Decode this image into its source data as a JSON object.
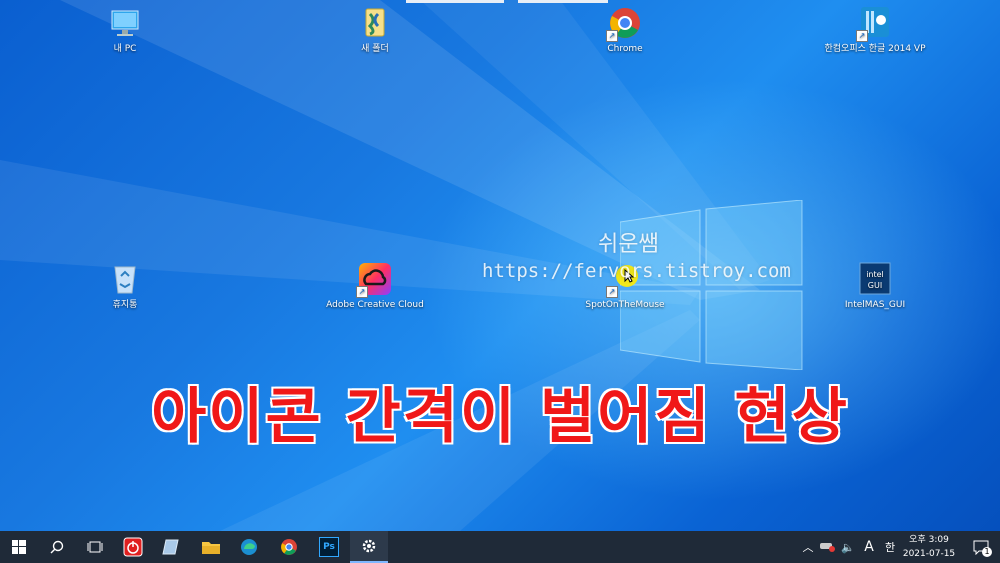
{
  "desktop": {
    "icons": [
      {
        "label": "내 PC",
        "icon": "this-pc-icon"
      },
      {
        "label": "새 폴더",
        "icon": "folder-icon"
      },
      {
        "label": "Chrome",
        "icon": "chrome-icon"
      },
      {
        "label": "한컴오피스 한글 2014 VP",
        "icon": "hancom-hwp-icon"
      },
      {
        "label": "휴지통",
        "icon": "recycle-bin-icon"
      },
      {
        "label": "Adobe Creative Cloud",
        "icon": "adobe-cc-icon"
      },
      {
        "label": "SpotOnTheMouse",
        "icon": "spot-mouse-icon"
      },
      {
        "label": "IntelMAS_GUI",
        "icon": "intel-gui-icon"
      }
    ],
    "watermark": {
      "line1": "쉬운쌤",
      "line2": "https://fervors.tistroy.com"
    },
    "caption": "아이콘 간격이 벌어짐 현상",
    "intel_icon_text": {
      "brand": "intel",
      "sub": "GUI"
    }
  },
  "taskbar": {
    "apps": [
      "windows-start-icon",
      "search-icon",
      "task-view-icon",
      "power-app-icon",
      "notepad-icon",
      "file-explorer-icon",
      "edge-icon",
      "chrome-icon",
      "photoshop-icon",
      "settings-gear-icon"
    ],
    "photoshop_label": "Ps",
    "tray": {
      "ime": "A",
      "lang": "한",
      "notification_count": "1"
    },
    "clock": {
      "time": "오후 3:09",
      "date": "2021-07-15"
    }
  },
  "colors": {
    "desktop_bg": "#1878e0",
    "caption_red": "#f01818",
    "taskbar": "#1f2a38"
  }
}
